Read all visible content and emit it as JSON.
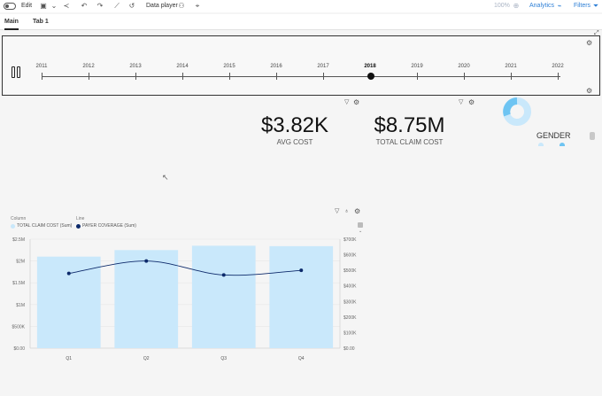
{
  "toolbar": {
    "edit_label": "Edit",
    "data_player_label": "Data player",
    "zoom_label": "100%",
    "analytics_label": "Analytics",
    "filters_label": "Filters"
  },
  "tabs": [
    {
      "label": "Main",
      "active": true
    },
    {
      "label": "Tab 1",
      "active": false
    }
  ],
  "timeline": {
    "years": [
      "2011",
      "2012",
      "2013",
      "2014",
      "2015",
      "2016",
      "2017",
      "2018",
      "2019",
      "2020",
      "2021",
      "2022"
    ],
    "selected_year": "2018"
  },
  "kpis": [
    {
      "value": "$3.82K",
      "label": "AVG COST"
    },
    {
      "value": "$8.75M",
      "label": "TOTAL CLAIM COST"
    }
  ],
  "gender": {
    "title": "GENDER"
  },
  "legend": {
    "column_heading": "Column",
    "column_series": "TOTAL CLAIM COST (Sum)",
    "line_heading": "Line",
    "line_series": "PAYER COVERAGE (Sum)"
  },
  "colors": {
    "bar": "#c9e8fb",
    "line": "#0d2a6b",
    "donut_light": "#c9e8fb",
    "donut_dark": "#6ec4f2"
  },
  "chart_data": {
    "type": "bar",
    "categories": [
      "Q1",
      "Q2",
      "Q3",
      "Q4"
    ],
    "series": [
      {
        "name": "TOTAL CLAIM COST (Sum)",
        "kind": "bar",
        "axis": "left",
        "values": [
          2100000,
          2250000,
          2350000,
          2340000
        ]
      },
      {
        "name": "PAYER COVERAGE (Sum)",
        "kind": "line",
        "axis": "right",
        "values": [
          480000,
          560000,
          470000,
          500000
        ]
      }
    ],
    "y_left": {
      "ticks": [
        "$0.00",
        "$500K",
        "$1M",
        "$1.5M",
        "$2M",
        "$2.5M"
      ],
      "range": [
        0,
        2500000
      ]
    },
    "y_right": {
      "ticks": [
        "$0.00",
        "$100K",
        "$200K",
        "$300K",
        "$400K",
        "$500K",
        "$600K",
        "$700K"
      ],
      "range": [
        0,
        700000
      ]
    },
    "grid": true
  }
}
